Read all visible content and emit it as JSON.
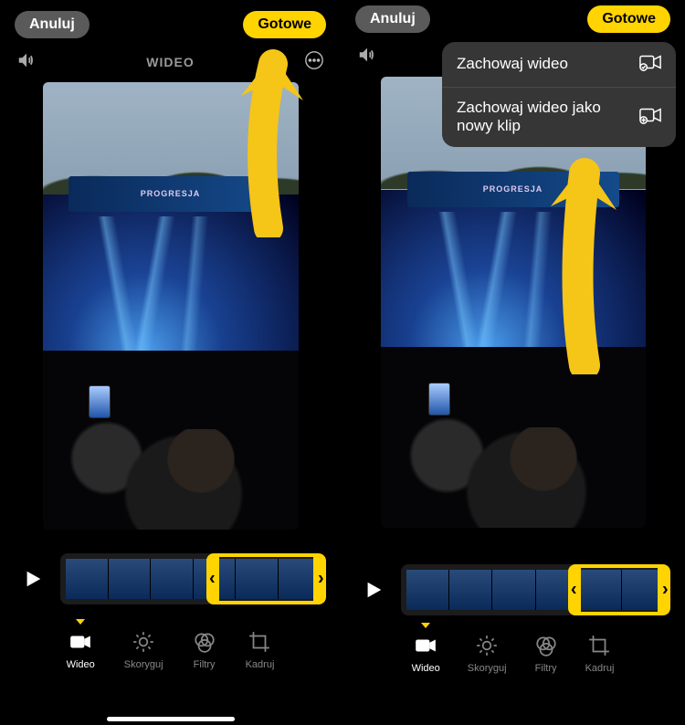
{
  "left": {
    "topbar": {
      "cancel": "Anuluj",
      "done": "Gotowe"
    },
    "subbar_title": "WIDEO",
    "banner_text": "PROGRESJA",
    "timeline_sel_left_pct": 55,
    "timeline_sel_right_pct": 100
  },
  "right": {
    "topbar": {
      "cancel": "Anuluj",
      "done": "Gotowe"
    },
    "menu": {
      "item1": "Zachowaj wideo",
      "item2": "Zachowaj wideo jako nowy klip"
    },
    "timeline_sel_left_pct": 62,
    "timeline_sel_right_pct": 100
  },
  "tabs": {
    "video": "Wideo",
    "adjust": "Skoryguj",
    "filters": "Filtry",
    "crop": "Kadruj"
  },
  "icons": {
    "volume": "volume-icon",
    "more": "more-icon",
    "play": "play-icon",
    "camera_check": "camera-check-icon",
    "camera_plus": "camera-plus-icon"
  }
}
